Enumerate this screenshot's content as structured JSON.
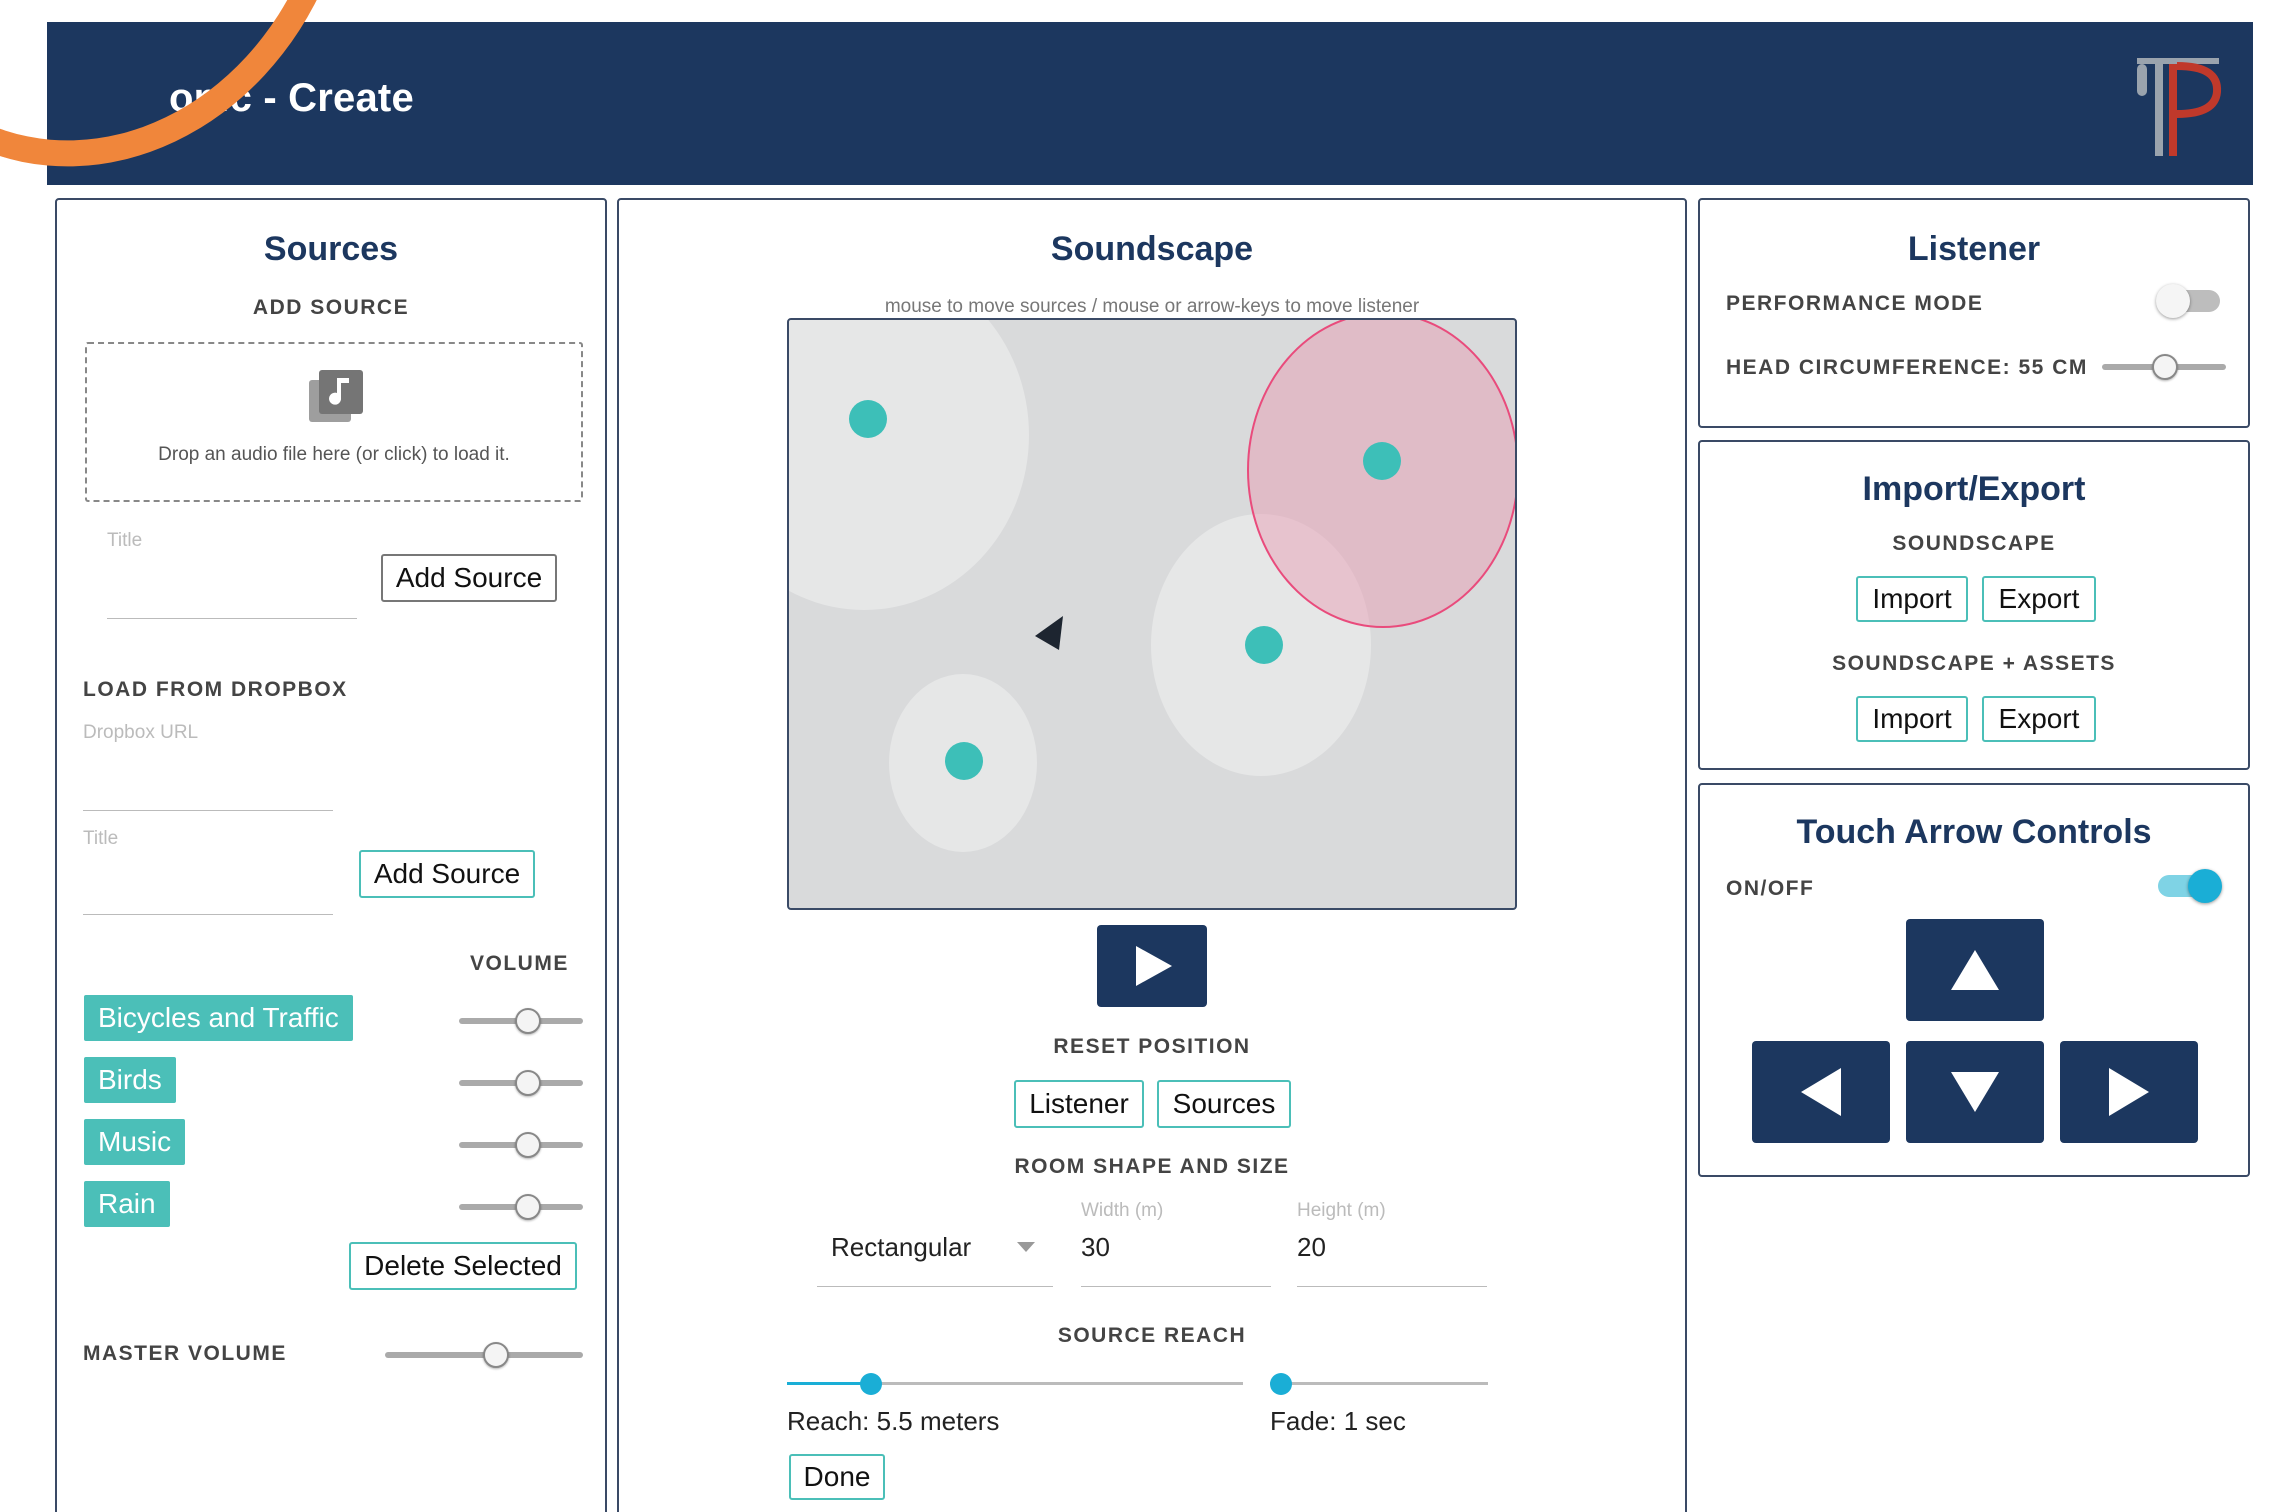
{
  "header": {
    "title": "onic - Create"
  },
  "sources": {
    "title": "Sources",
    "add_source_label": "ADD SOURCE",
    "drop_text": "Drop an audio file here (or click) to load it.",
    "title_placeholder": "Title",
    "add_source_button": "Add Source",
    "dropbox_label": "LOAD FROM DROPBOX",
    "dropbox_placeholder": "Dropbox URL",
    "title2_placeholder": "Title",
    "add_source_button2": "Add Source",
    "volume_label": "VOLUME",
    "items": [
      {
        "label": "Bicycles and Traffic",
        "volume": 0.55
      },
      {
        "label": "Birds",
        "volume": 0.55
      },
      {
        "label": "Music",
        "volume": 0.55
      },
      {
        "label": "Rain",
        "volume": 0.55
      }
    ],
    "delete_button": "Delete Selected",
    "master_volume_label": "MASTER VOLUME",
    "master_volume": 0.55
  },
  "soundscape": {
    "title": "Soundscape",
    "hint": "mouse to move sources / mouse or arrow-keys to move listener",
    "reset_label": "RESET POSITION",
    "reset_listener": "Listener",
    "reset_sources": "Sources",
    "room_label": "ROOM SHAPE AND SIZE",
    "shape_value": "Rectangular",
    "width_label": "Width (m)",
    "width_value": "30",
    "height_label": "Height (m)",
    "height_value": "20",
    "reach_label": "SOURCE REACH",
    "reach_text": "Reach: 5.5 meters",
    "fade_text": "Fade: 1 sec",
    "reach_fraction": 0.18,
    "fade_fraction": 0.05,
    "done_button": "Done"
  },
  "listener": {
    "title": "Listener",
    "performance_label": "PERFORMANCE MODE",
    "performance_on": false,
    "head_label": "HEAD CIRCUMFERENCE: 55 CM",
    "head_fraction": 0.5
  },
  "import_export": {
    "title": "Import/Export",
    "soundscape_label": "SOUNDSCAPE",
    "assets_label": "SOUNDSCAPE + ASSETS",
    "import": "Import",
    "export": "Export"
  },
  "touch": {
    "title": "Touch Arrow Controls",
    "onoff_label": "ON/OFF",
    "on": true
  },
  "colors": {
    "header": "#1c375f",
    "accent": "#4bbfb8",
    "highlight": "#e94b7c",
    "orange": "#f0863b"
  }
}
